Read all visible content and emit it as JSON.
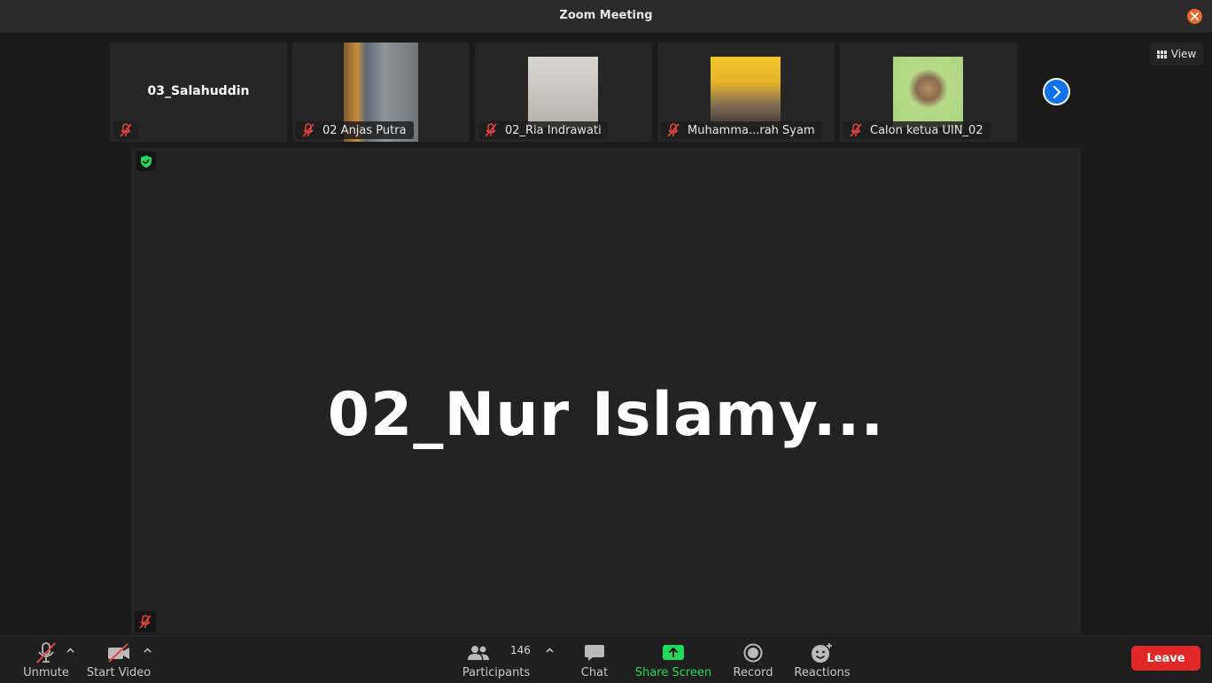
{
  "window": {
    "title": "Zoom Meeting"
  },
  "view_button": {
    "label": "View"
  },
  "participants_strip": [
    {
      "name": "03_Salahuddin",
      "has_video": false,
      "muted": true
    },
    {
      "name": "02 Anjas Putra",
      "has_video": true,
      "muted": true
    },
    {
      "name": "02_Ria Indrawati",
      "has_video": true,
      "muted": true
    },
    {
      "name": "Muhamma...rah Syam",
      "has_video": true,
      "muted": true
    },
    {
      "name": "Calon ketua UIN_02",
      "has_video": true,
      "muted": true
    }
  ],
  "active_speaker": {
    "name": "02_Nur Islamy...",
    "muted": true
  },
  "toolbar": {
    "unmute_label": "Unmute",
    "start_video_label": "Start Video",
    "participants_label": "Participants",
    "participants_count": "146",
    "chat_label": "Chat",
    "share_screen_label": "Share Screen",
    "record_label": "Record",
    "reactions_label": "Reactions",
    "leave_label": "Leave"
  },
  "colors": {
    "accent_blue": "#0e72ed",
    "share_green": "#23d959",
    "leave_red": "#e02828",
    "mute_red": "#e8453c",
    "close_orange": "#e8692c"
  }
}
